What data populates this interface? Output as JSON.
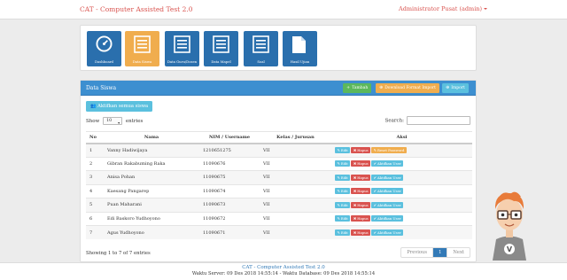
{
  "navbar": {
    "brand": "CAT - Computer Assisted Test 2.0",
    "user": "Administrator Pusat (admin)"
  },
  "tiles": [
    {
      "label": "Dashboard",
      "icon": "speedometer-icon"
    },
    {
      "label": "Data Siswa",
      "icon": "list-icon"
    },
    {
      "label": "Data Guru/Dosen",
      "icon": "list-icon"
    },
    {
      "label": "Data Mapel",
      "icon": "list-icon"
    },
    {
      "label": "Soal",
      "icon": "list-icon"
    },
    {
      "label": "Hasil Ujian",
      "icon": "document-icon"
    }
  ],
  "panel": {
    "title": "Data Siswa",
    "tambah": "Tambah",
    "download": "Download Format Import",
    "import": "Import",
    "aktifkan_all": "Aktifkan semua siswa"
  },
  "table_ctrl": {
    "show": "Show",
    "entries": "entries",
    "page_size": "10",
    "search": "Search:"
  },
  "columns": [
    "No",
    "Nama",
    "NIM / Username",
    "Kelas / Jurusan",
    "Aksi"
  ],
  "actions": {
    "edit": "Edit",
    "hapus": "Hapus",
    "reset": "Reset Password",
    "aktifkan": "Aktifkan User"
  },
  "rows": [
    {
      "no": "1",
      "nama": "Vanny Hadiwijaya",
      "nim": "1210651275",
      "kelas": "VII"
    },
    {
      "no": "2",
      "nama": "Gibran Rakabuming Raka",
      "nim": "11090676",
      "kelas": "VII"
    },
    {
      "no": "3",
      "nama": "Anisa Pohan",
      "nim": "11090675",
      "kelas": "VII"
    },
    {
      "no": "4",
      "nama": "Kaesang Pangarep",
      "nim": "11090674",
      "kelas": "VII"
    },
    {
      "no": "5",
      "nama": "Puan Maharani",
      "nim": "11090673",
      "kelas": "VII"
    },
    {
      "no": "6",
      "nama": "Edi Baskoro Yudhoyono",
      "nim": "11090672",
      "kelas": "VII"
    },
    {
      "no": "7",
      "nama": "Agus Yudhoyono",
      "nim": "11090671",
      "kelas": "VII"
    }
  ],
  "footer_info": {
    "showing": "Showing 1 to 7 of 7 entries",
    "previous": "Previous",
    "page": "1",
    "next": "Next"
  },
  "footer": {
    "title": "CAT - Computer Assisted Test 2.0",
    "time": "Waktu Server: 09 Des 2018 14:55:14 - Waktu Database: 09 Des 2018 14:55:14"
  },
  "mascot_letter": "V",
  "colors": {
    "brand": "#d9534f",
    "tile_blue": "#2a6fad",
    "tile_active": "#f0ad4e",
    "panel_head": "#3d8fd0",
    "success": "#5cb85c",
    "warning": "#f0ad4e",
    "info": "#5bc0de",
    "danger": "#d9534f"
  }
}
